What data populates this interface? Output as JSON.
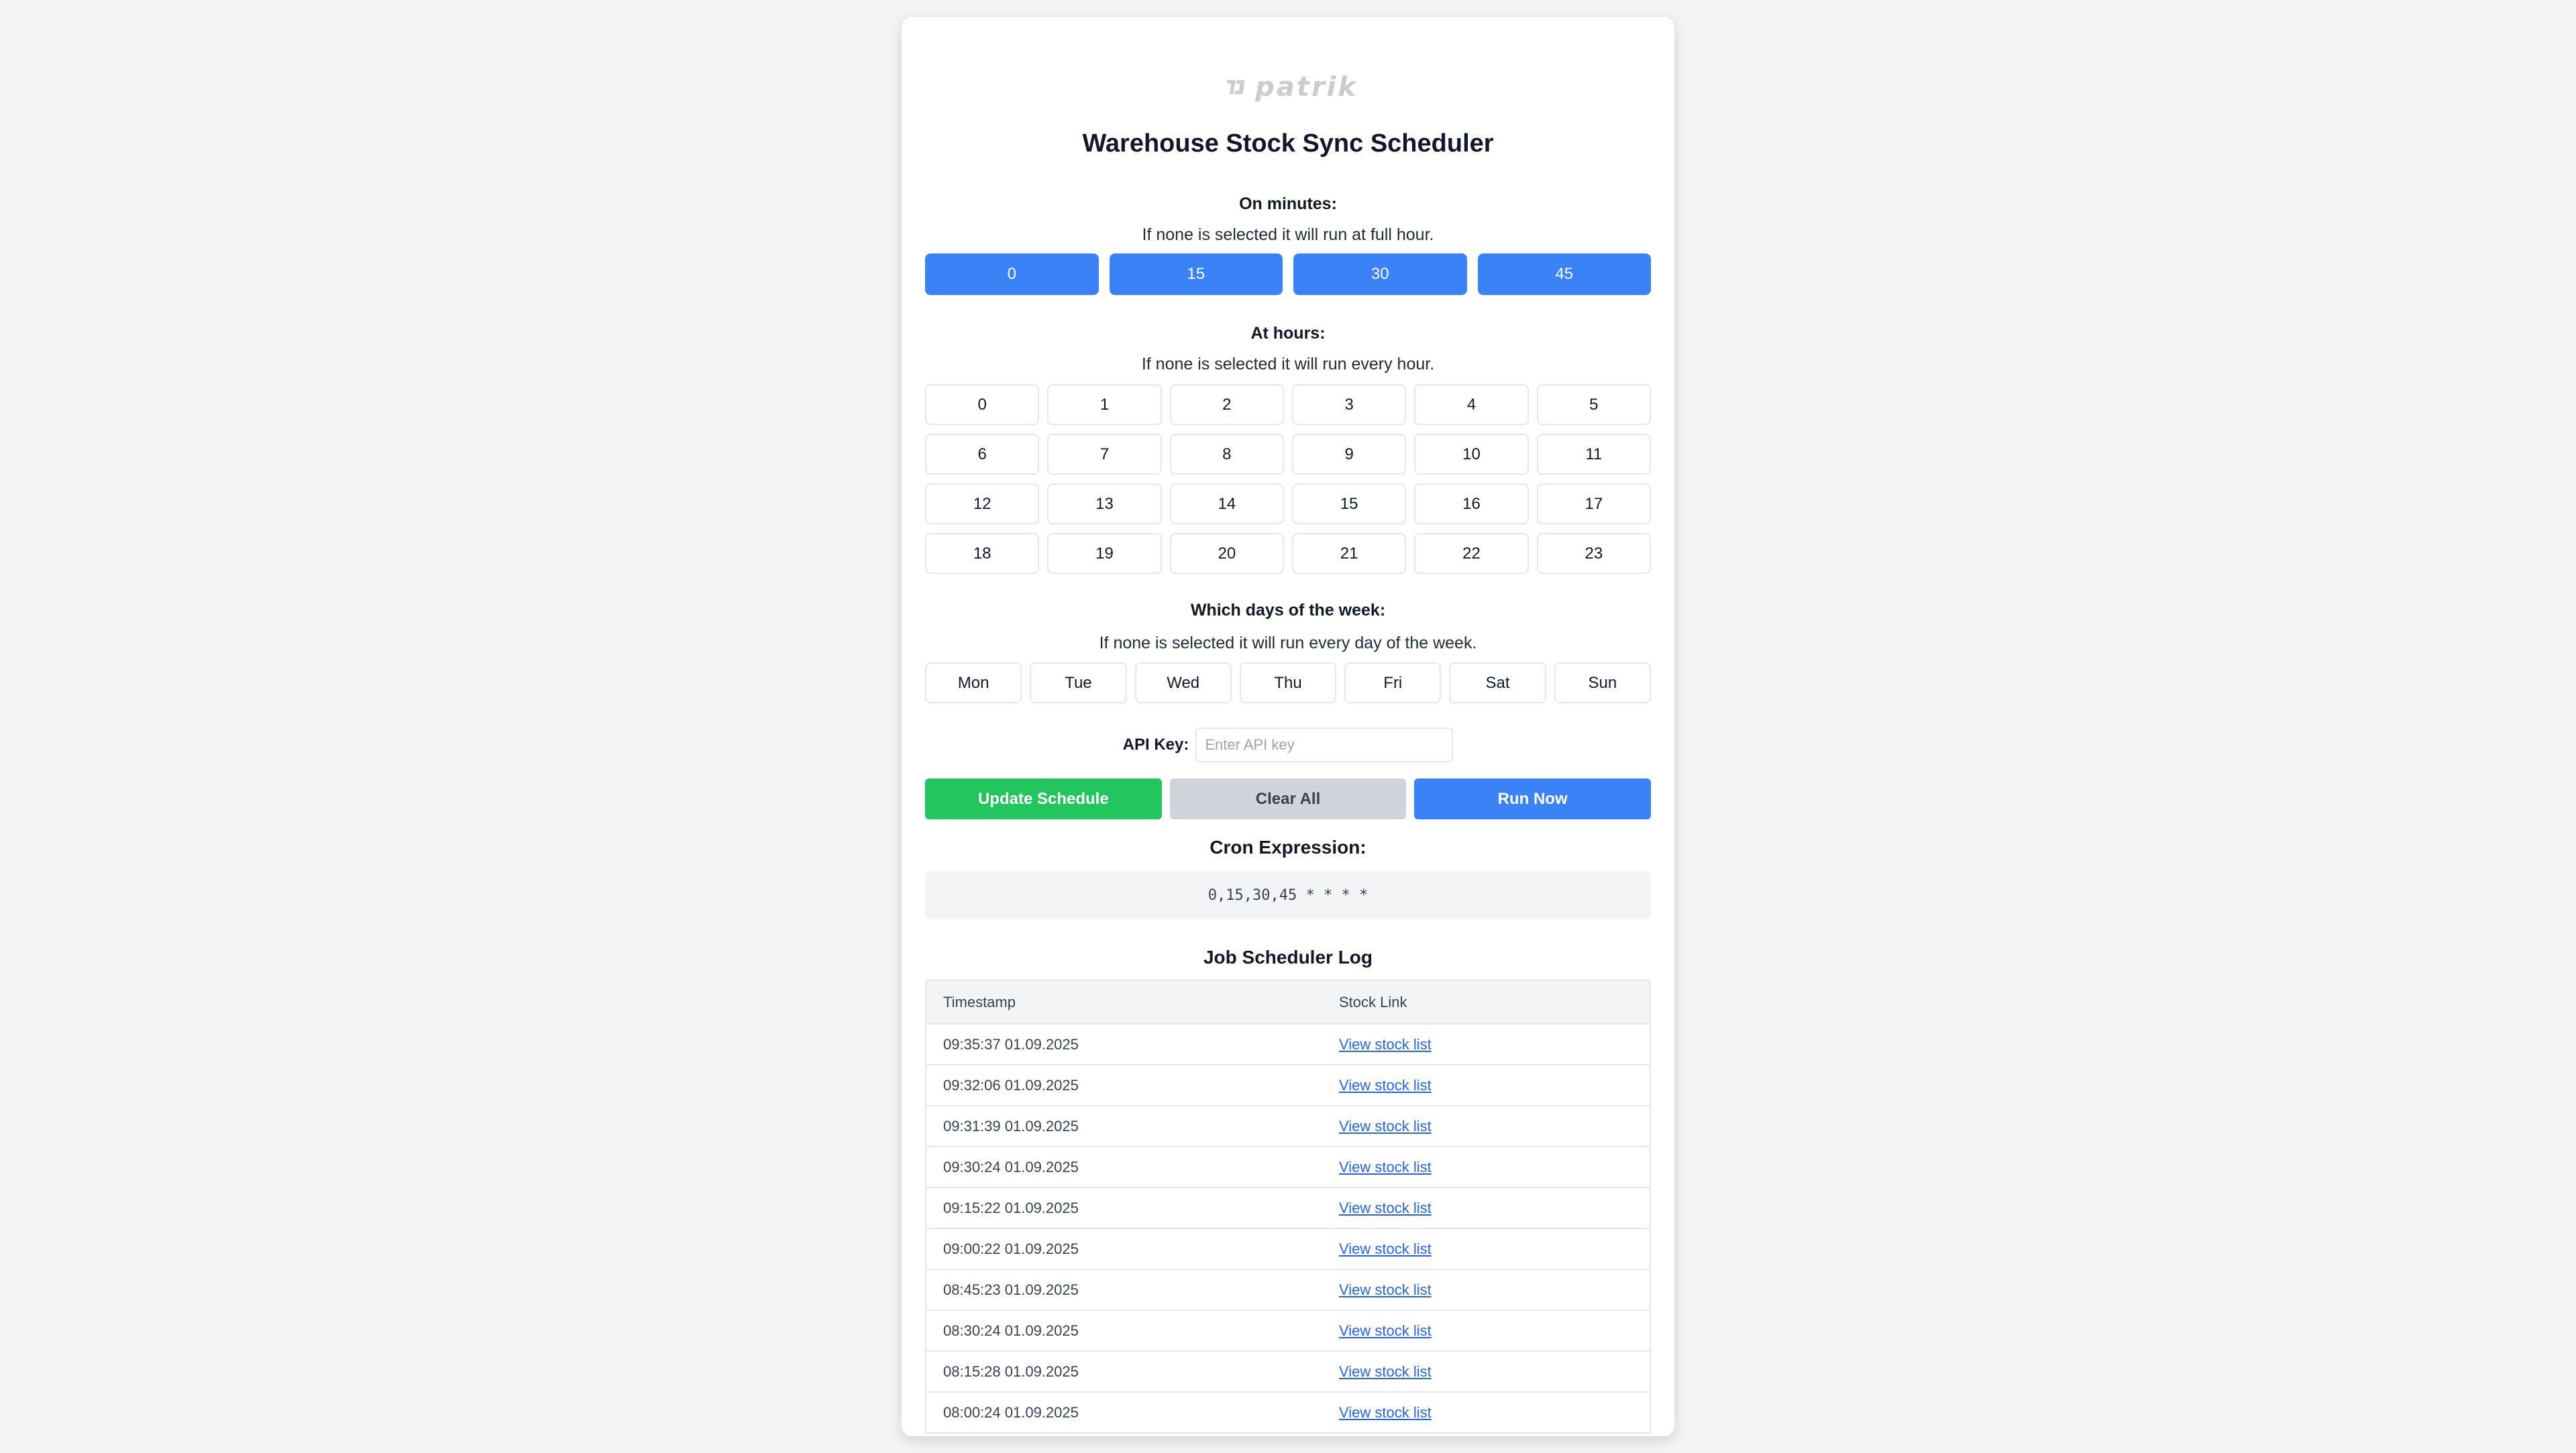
{
  "logo": {
    "text": "patrik"
  },
  "title": "Warehouse Stock Sync Scheduler",
  "minutes": {
    "title": "On minutes:",
    "subtitle": "If none is selected it will run at full hour.",
    "options": [
      "0",
      "15",
      "30",
      "45"
    ],
    "selected": [
      "0",
      "15",
      "30",
      "45"
    ]
  },
  "hours": {
    "title": "At hours:",
    "subtitle": "If none is selected it will run every hour.",
    "options": [
      "0",
      "1",
      "2",
      "3",
      "4",
      "5",
      "6",
      "7",
      "8",
      "9",
      "10",
      "11",
      "12",
      "13",
      "14",
      "15",
      "16",
      "17",
      "18",
      "19",
      "20",
      "21",
      "22",
      "23"
    ]
  },
  "days": {
    "title": "Which days of the week:",
    "subtitle": "If none is selected it will run every day of the week.",
    "options": [
      "Mon",
      "Tue",
      "Wed",
      "Thu",
      "Fri",
      "Sat",
      "Sun"
    ]
  },
  "api": {
    "label": "API Key:",
    "placeholder": "Enter API key",
    "value": ""
  },
  "actions": {
    "update": "Update Schedule",
    "clear": "Clear All",
    "run": "Run Now"
  },
  "cron": {
    "title": "Cron Expression:",
    "expression": "0,15,30,45 * * * *"
  },
  "log": {
    "title": "Job Scheduler Log",
    "columns": [
      "Timestamp",
      "Stock Link"
    ],
    "rows": [
      {
        "timestamp": "09:35:37 01.09.2025",
        "link": "View stock list"
      },
      {
        "timestamp": "09:32:06 01.09.2025",
        "link": "View stock list"
      },
      {
        "timestamp": "09:31:39 01.09.2025",
        "link": "View stock list"
      },
      {
        "timestamp": "09:30:24 01.09.2025",
        "link": "View stock list"
      },
      {
        "timestamp": "09:15:22 01.09.2025",
        "link": "View stock list"
      },
      {
        "timestamp": "09:00:22 01.09.2025",
        "link": "View stock list"
      },
      {
        "timestamp": "08:45:23 01.09.2025",
        "link": "View stock list"
      },
      {
        "timestamp": "08:30:24 01.09.2025",
        "link": "View stock list"
      },
      {
        "timestamp": "08:15:28 01.09.2025",
        "link": "View stock list"
      },
      {
        "timestamp": "08:00:24 01.09.2025",
        "link": "View stock list"
      }
    ]
  },
  "colors": {
    "selected_minute": "#3b82f6",
    "update_button": "#22c55e",
    "clear_button": "#d1d5db",
    "run_button": "#3b82f6",
    "link": "#2563eb"
  }
}
